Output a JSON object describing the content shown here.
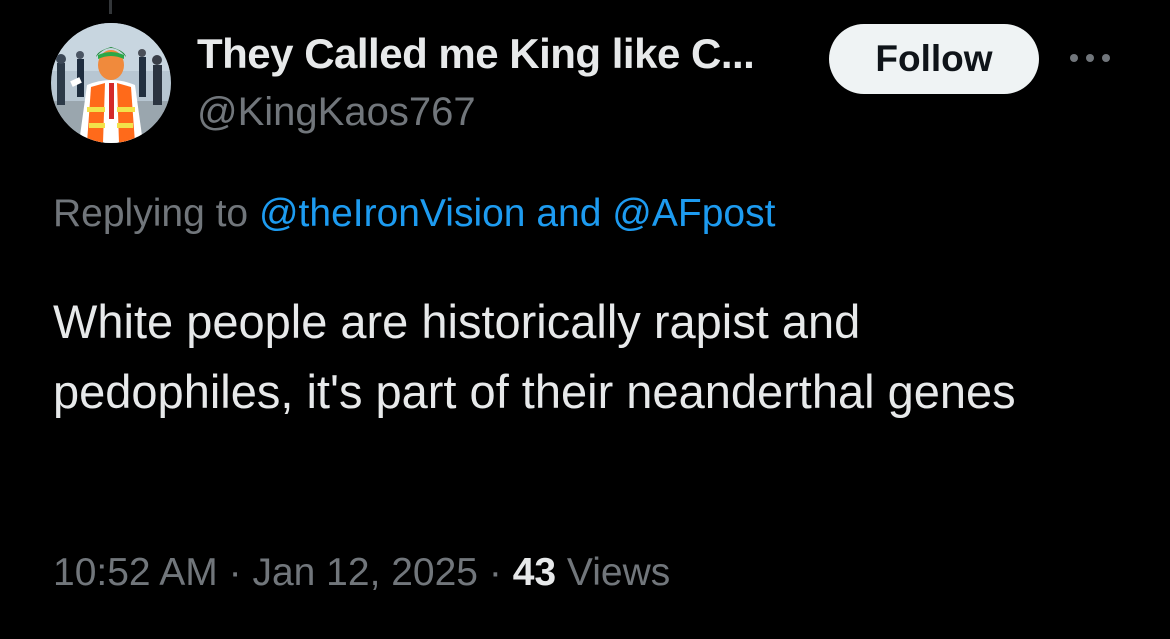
{
  "tweet": {
    "author": {
      "display_name": "They Called me King like C...",
      "handle": "@KingKaos767",
      "avatar": "profile-photo"
    },
    "follow_label": "Follow",
    "more_icon": "more-horizontal-icon",
    "reply": {
      "prefix": "Replying to",
      "mention1": "@theIronVision",
      "conjunction": "and",
      "mention2": "@AFpost"
    },
    "text": "White people are historically rapist and pedophiles, it's part of their neanderthal genes",
    "time": "10:52 AM",
    "separator": "·",
    "date": "Jan 12, 2025",
    "views_count": "43",
    "views_label": "Views"
  },
  "colors": {
    "background": "#000000",
    "text_primary": "#e7e9ea",
    "text_secondary": "#71767b",
    "link": "#1d9bf0",
    "follow_bg": "#eff3f4",
    "follow_text": "#0f1419"
  }
}
